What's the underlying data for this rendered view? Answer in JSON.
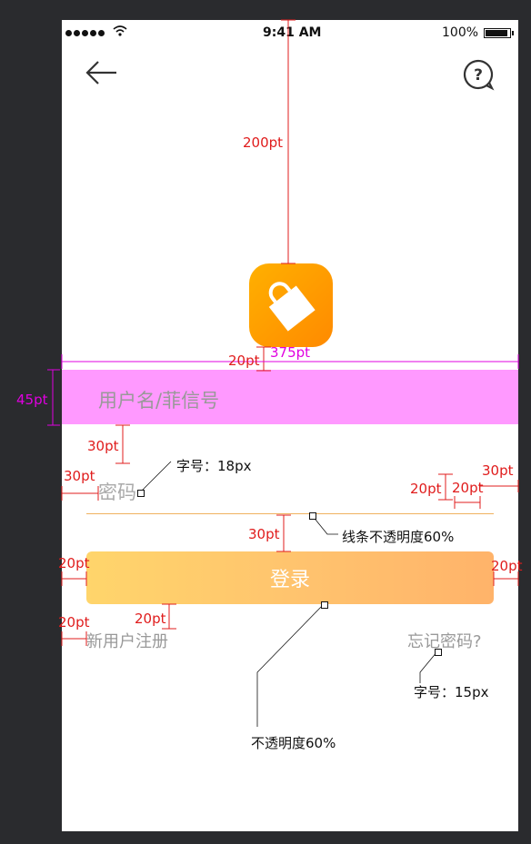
{
  "status_bar": {
    "time": "9:41 AM",
    "battery_pct": "100%"
  },
  "nav": {
    "back_icon": "arrow-left-icon",
    "help_icon": "question-bubble-icon"
  },
  "logo": {
    "icon": "shopping-bag-icon",
    "colors": [
      "#ffb000",
      "#ff8a00"
    ]
  },
  "form": {
    "username_placeholder": "用户名/菲信号",
    "password_label": "密码",
    "login_label": "登录",
    "register_label": "新用户注册",
    "forgot_label": "忘记密码?"
  },
  "annotations": {
    "top_gap": "200pt",
    "logo_gap": "20pt",
    "width": "375pt",
    "field_height": "45pt",
    "field_gap": "30pt",
    "left_inset": "30pt",
    "font_note": "字号：18px",
    "right_gap_a": "20pt",
    "right_gap_b": "20pt",
    "right_inset": "30pt",
    "line_gap": "30pt",
    "line_note": "线条不透明度60%",
    "btn_left": "20pt",
    "btn_right": "20pt",
    "link_left": "20pt",
    "link_gap": "20pt",
    "link_font_note": "字号：15px",
    "btn_note": "不透明度60%"
  },
  "colors": {
    "accent_red": "#e01c1c",
    "accent_magenta": "#e000e0",
    "button_gradient": [
      "#ffd56b",
      "#ffb36a"
    ],
    "username_band": "#ff99ff"
  }
}
